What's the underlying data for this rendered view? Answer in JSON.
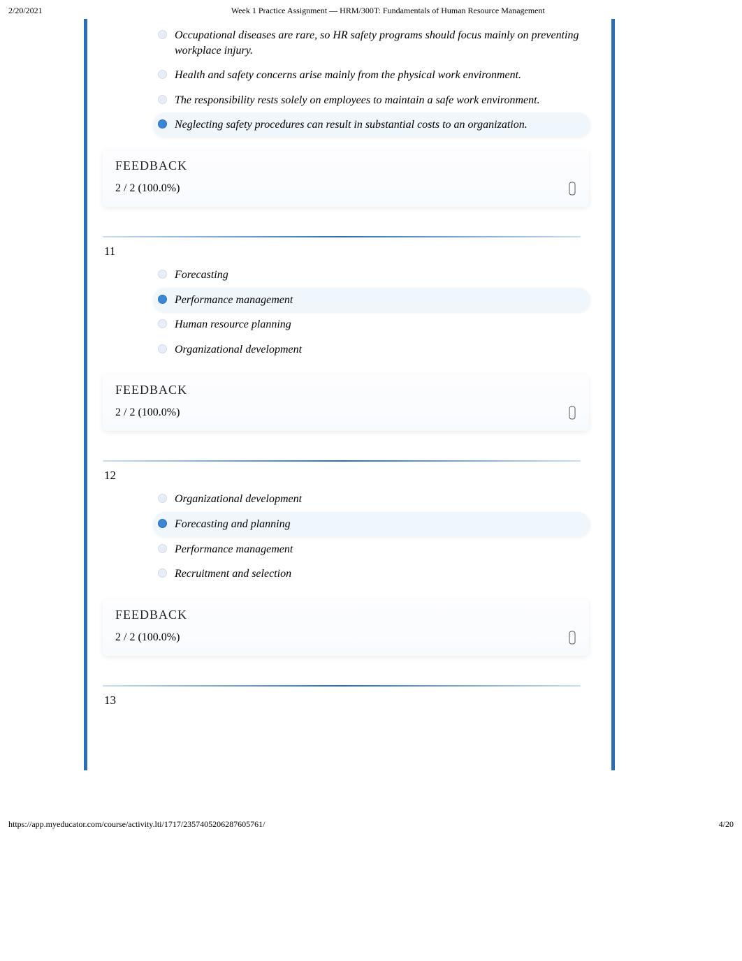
{
  "header": {
    "date": "2/20/2021",
    "title": "Week 1 Practice Assignment — HRM/300T: Fundamentals of Human Resource Management"
  },
  "footer": {
    "url": "https://app.myeducator.com/course/activity.lti/1717/2357405206287605761/",
    "page": "4/20"
  },
  "feedback_label": "FEEDBACK",
  "q10": {
    "options": [
      {
        "text": "Occupational diseases are rare, so HR safety programs should focus mainly on preventing workplace injury.",
        "selected": false
      },
      {
        "text": "Health and safety concerns arise mainly from the physical work environment.",
        "selected": false
      },
      {
        "text": "The responsibility rests solely on employees to maintain a safe work environment.",
        "selected": false
      },
      {
        "text": "Neglecting safety procedures can result in substantial costs to an organization.",
        "selected": true
      }
    ],
    "score": "2 / 2 (100.0%)"
  },
  "q11": {
    "number": "11",
    "options": [
      {
        "text": "Forecasting",
        "selected": false
      },
      {
        "text": "Performance management",
        "selected": true
      },
      {
        "text": "Human resource planning",
        "selected": false
      },
      {
        "text": "Organizational development",
        "selected": false
      }
    ],
    "score": "2 / 2 (100.0%)"
  },
  "q12": {
    "number": "12",
    "options": [
      {
        "text": "Organizational development",
        "selected": false
      },
      {
        "text": "Forecasting and planning",
        "selected": true
      },
      {
        "text": "Performance management",
        "selected": false
      },
      {
        "text": "Recruitment and selection",
        "selected": false
      }
    ],
    "score": "2 / 2 (100.0%)"
  },
  "q13": {
    "number": "13"
  }
}
